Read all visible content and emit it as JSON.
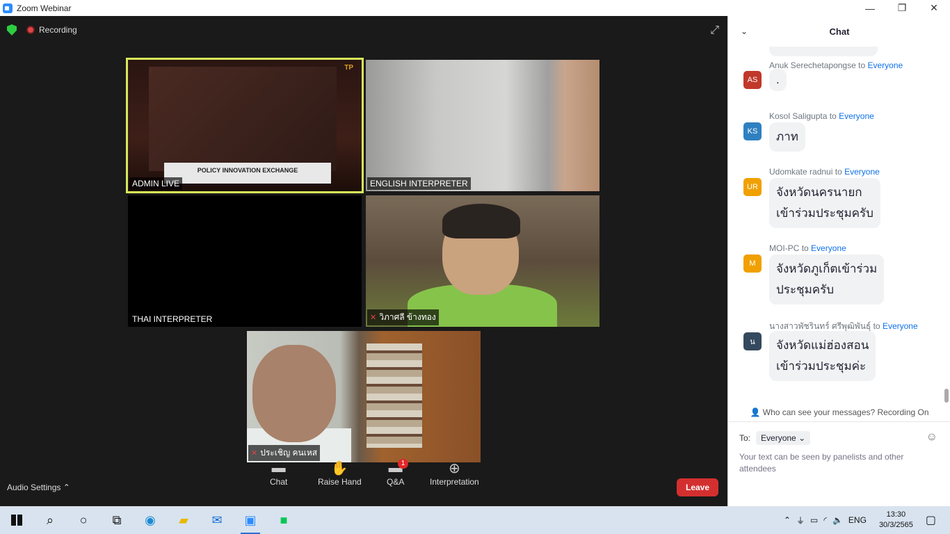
{
  "window": {
    "title": "Zoom Webinar",
    "minimize": "—",
    "restore": "❐",
    "close": "✕"
  },
  "meeting": {
    "recording_label": "Recording",
    "fullscreen_icon": "⤢",
    "tiles": [
      {
        "name": "ADMIN LIVE",
        "stage_text": "POLICY INNOVATION EXCHANGE",
        "logo_text": "TP"
      },
      {
        "name": "ENGLISH  INTERPRETER"
      },
      {
        "name": "THAI INTERPRETER"
      },
      {
        "name": "วิภาศลี ข้างทอง",
        "muted": true
      },
      {
        "name": "ประเชิญ คนเหส",
        "muted": true
      }
    ]
  },
  "controls": {
    "audio_settings": "Audio Settings",
    "audio_chevron": "⌃",
    "chat": "Chat",
    "raise_hand": "Raise Hand",
    "qa": "Q&A",
    "qa_badge": "1",
    "interpretation": "Interpretation",
    "leave": "Leave"
  },
  "chat": {
    "title": "Chat",
    "collapse_icon": "⌄",
    "messages": [
      {
        "sender": "",
        "to": "",
        "initials": "",
        "color": "",
        "text": ""
      },
      {
        "sender": "Anuk Serechetapongse",
        "to": "Everyone",
        "initials": "AS",
        "color": "#c0392b",
        "text": "."
      },
      {
        "sender": "Kosol Saligupta",
        "to": "Everyone",
        "initials": "KS",
        "color": "#2f80c1",
        "text": "ภาท"
      },
      {
        "sender": "Udomkate radnui",
        "to": "Everyone",
        "initials": "UR",
        "color": "#f0a000",
        "line1": "จังหวัดนครนายก",
        "line2": "เข้าร่วมประชุมครับ"
      },
      {
        "sender": "MOI-PC",
        "to": "Everyone",
        "initials": "M",
        "color": "#f0a000",
        "line1": "จังหวัดภูเก็ตเข้าร่วม",
        "line2": "ประชุมครับ"
      },
      {
        "sender": "นางสาวพัชรินทร์ ศรีพุฒิพันธุ์",
        "to": "Everyone",
        "initials": "น",
        "color": "#34495e",
        "line1": "จังหวัดแม่ฮ่องสอน",
        "line2": "เข้าร่วมประชุมค่ะ"
      }
    ],
    "connector": "to",
    "who_can_see": "Who can see your messages? Recording On",
    "to_label": "To:",
    "to_value": "Everyone",
    "placeholder": "Your text can be seen by panelists and other attendees"
  },
  "taskbar": {
    "lang": "ENG",
    "time": "13:30",
    "date": "30/3/2565"
  }
}
